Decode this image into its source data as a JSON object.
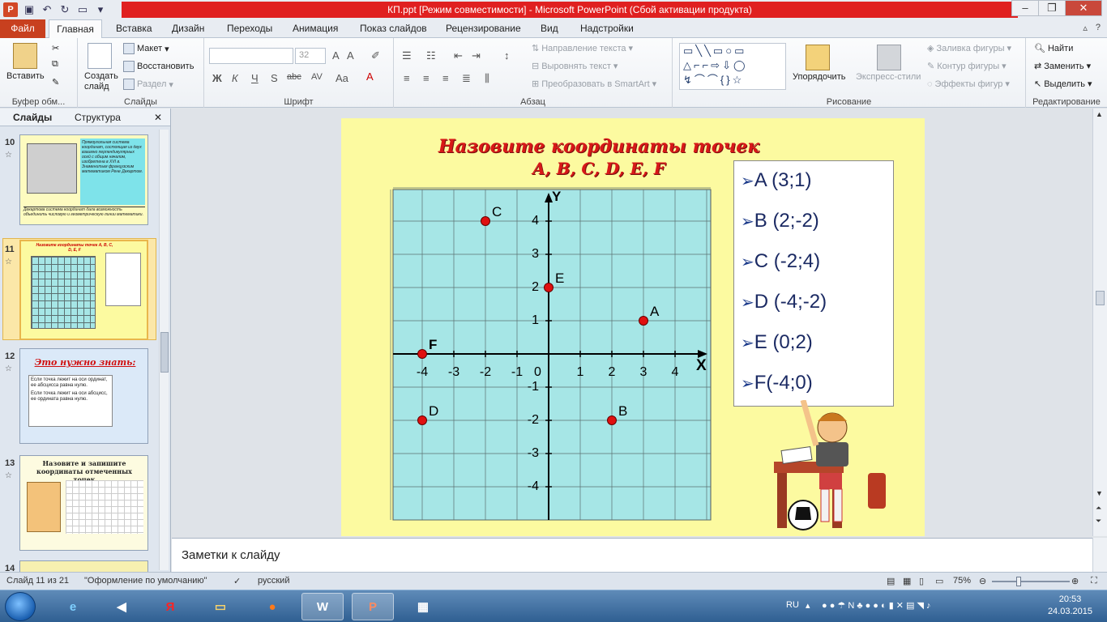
{
  "window": {
    "title": "КП.ppt [Режим совместимости] - Microsoft PowerPoint (Сбой активации продукта)"
  },
  "ribbon": {
    "tabs": [
      "Файл",
      "Главная",
      "Вставка",
      "Дизайн",
      "Переходы",
      "Анимация",
      "Показ слайдов",
      "Рецензирование",
      "Вид",
      "Надстройки"
    ],
    "groups": {
      "clipboard": {
        "label": "Буфер обм...",
        "paste": "Вставить"
      },
      "slides": {
        "label": "Слайды",
        "new_slide": "Создать слайд",
        "layout": "Макет",
        "reset": "Восстановить",
        "section": "Раздел"
      },
      "font": {
        "label": "Шрифт",
        "size": "32"
      },
      "paragraph": {
        "label": "Абзац",
        "text_direction": "Направление текста",
        "align_text": "Выровнять текст",
        "smartart": "Преобразовать в SmartArt"
      },
      "drawing": {
        "label": "Рисование",
        "arrange": "Упорядочить",
        "quick_styles": "Экспресс-стили",
        "fill": "Заливка фигуры",
        "outline": "Контур фигуры",
        "effects": "Эффекты фигур"
      },
      "editing": {
        "label": "Редактирование",
        "find": "Найти",
        "replace": "Заменить",
        "select": "Выделить"
      }
    }
  },
  "left_pane": {
    "tabs": [
      "Слайды",
      "Структура"
    ],
    "slides": [
      {
        "number": "10",
        "text": "Прямоугольная система координат, состоящая из двух взаимно перпендикулярных осей с общим началом, изобретена в XVI в. Знаменитым французским математиком Рене Декартом.",
        "caption": "Декартова система координат дала возможность объединить числовую и геометрическую линии математики."
      },
      {
        "number": "11",
        "title": "Назовите координаты точек A, B, C, D, E, F"
      },
      {
        "number": "12",
        "title": "Это нужно знать:",
        "items": [
          "Если точка лежит на оси ординат, ее абсцисса равна нулю.",
          "Если точка лежит на оси абсцисс, ее ордината равна нулю."
        ]
      },
      {
        "number": "13",
        "title": "Назовите и запишите координаты отмеченных точек"
      },
      {
        "number": "14"
      }
    ]
  },
  "slide": {
    "title_line1": "Назовите координаты точек",
    "title_line2": "A, B, C, D, E, F",
    "axis_x": "X",
    "axis_y": "Y",
    "answers": [
      "A (3;1)",
      "B (2;-2)",
      "C (-2;4)",
      "D (-4;-2)",
      "E (0;2)",
      "F(-4;0)"
    ]
  },
  "chart_data": {
    "type": "scatter",
    "xlabel": "X",
    "ylabel": "Y",
    "x_ticks": [
      -4,
      -3,
      -2,
      -1,
      1,
      2,
      3,
      4
    ],
    "y_ticks": [
      4,
      3,
      2,
      1,
      -1,
      -2,
      -3,
      -4
    ],
    "origin_label": "0",
    "xlim": [
      -5,
      5
    ],
    "ylim": [
      -5,
      5
    ],
    "grid": true,
    "points": [
      {
        "name": "A",
        "x": 3,
        "y": 1
      },
      {
        "name": "B",
        "x": 2,
        "y": -2
      },
      {
        "name": "C",
        "x": -2,
        "y": 4
      },
      {
        "name": "D",
        "x": -4,
        "y": -2
      },
      {
        "name": "E",
        "x": 0,
        "y": 2
      },
      {
        "name": "F",
        "x": -4,
        "y": 0
      }
    ],
    "colors": {
      "background": "#a6e6e6",
      "point": "#e01010",
      "grid": "#5b6f70",
      "axis": "#000000"
    }
  },
  "notes": {
    "placeholder": "Заметки к слайду"
  },
  "status": {
    "slide_info": "Слайд 11 из 21",
    "theme": "\"Оформление по умолчанию\"",
    "language": "русский",
    "zoom": "75%"
  },
  "taskbar": {
    "language": "RU",
    "time": "20:53",
    "date": "24.03.2015"
  }
}
